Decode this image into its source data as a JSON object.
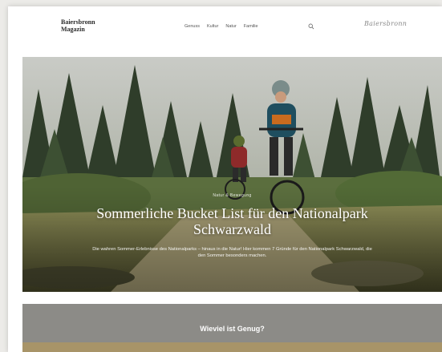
{
  "header": {
    "brand_line1": "Baiersbronn",
    "brand_line2": "Magazin",
    "nav": [
      "Genuss",
      "Kultur",
      "Natur",
      "Familie"
    ],
    "search_icon": "search-icon",
    "script_logo": "Baiersbronn"
  },
  "hero": {
    "kicker": "Natur & Bewegung",
    "title": "Sommerliche Bucket List für den Nationalpark Schwarzwald",
    "lead": "Die wahren Sommer-Erlebnisse des Nationalparks – hinaus in die Natur! Hier kommen 7 Gründe für den Nationalpark Schwarzwald, die den Sommer besonders machen."
  },
  "band": {
    "title": "Wieviel ist Genug?",
    "color": "#8c8b87",
    "strip_color": "#a89468"
  }
}
